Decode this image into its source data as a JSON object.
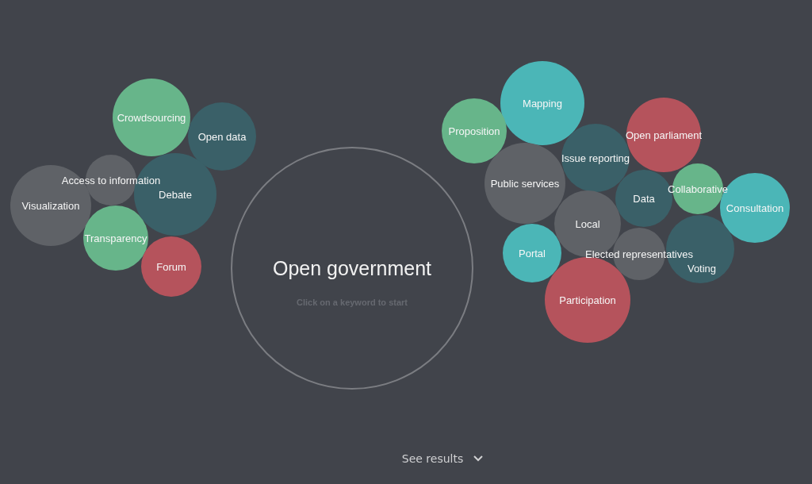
{
  "left_cluster": [
    {
      "label": "Crowdsourcing",
      "color": "#67b58a"
    },
    {
      "label": "Open data",
      "color": "#3a6068"
    },
    {
      "label": "Access to information",
      "color": "#5f6267"
    },
    {
      "label": "Debate",
      "color": "#3a6068"
    },
    {
      "label": "Visualization",
      "color": "#5f6267"
    },
    {
      "label": "Transparency",
      "color": "#67b58a"
    },
    {
      "label": "Forum",
      "color": "#b5535c"
    }
  ],
  "topic": {
    "title": "Open government",
    "hint": "Click on a keyword to start"
  },
  "right_cluster": [
    {
      "label": "Mapping",
      "color": "#4bb6b7"
    },
    {
      "label": "Proposition",
      "color": "#67b58a"
    },
    {
      "label": "Open parliament",
      "color": "#b5535c"
    },
    {
      "label": "Issue reporting",
      "color": "#3a6068"
    },
    {
      "label": "Public services",
      "color": "#5f6267"
    },
    {
      "label": "Collaborative",
      "color": "#67b58a"
    },
    {
      "label": "Data",
      "color": "#3a6068"
    },
    {
      "label": "Consultation",
      "color": "#4bb6b7"
    },
    {
      "label": "Local",
      "color": "#5f6267"
    },
    {
      "label": "Voting",
      "color": "#3a6068"
    },
    {
      "label": "Portal",
      "color": "#4bb6b7"
    },
    {
      "label": "Elected representatives",
      "color": "#5f6267"
    },
    {
      "label": "Participation",
      "color": "#b5535c"
    }
  ],
  "footer": {
    "link": "See results"
  }
}
